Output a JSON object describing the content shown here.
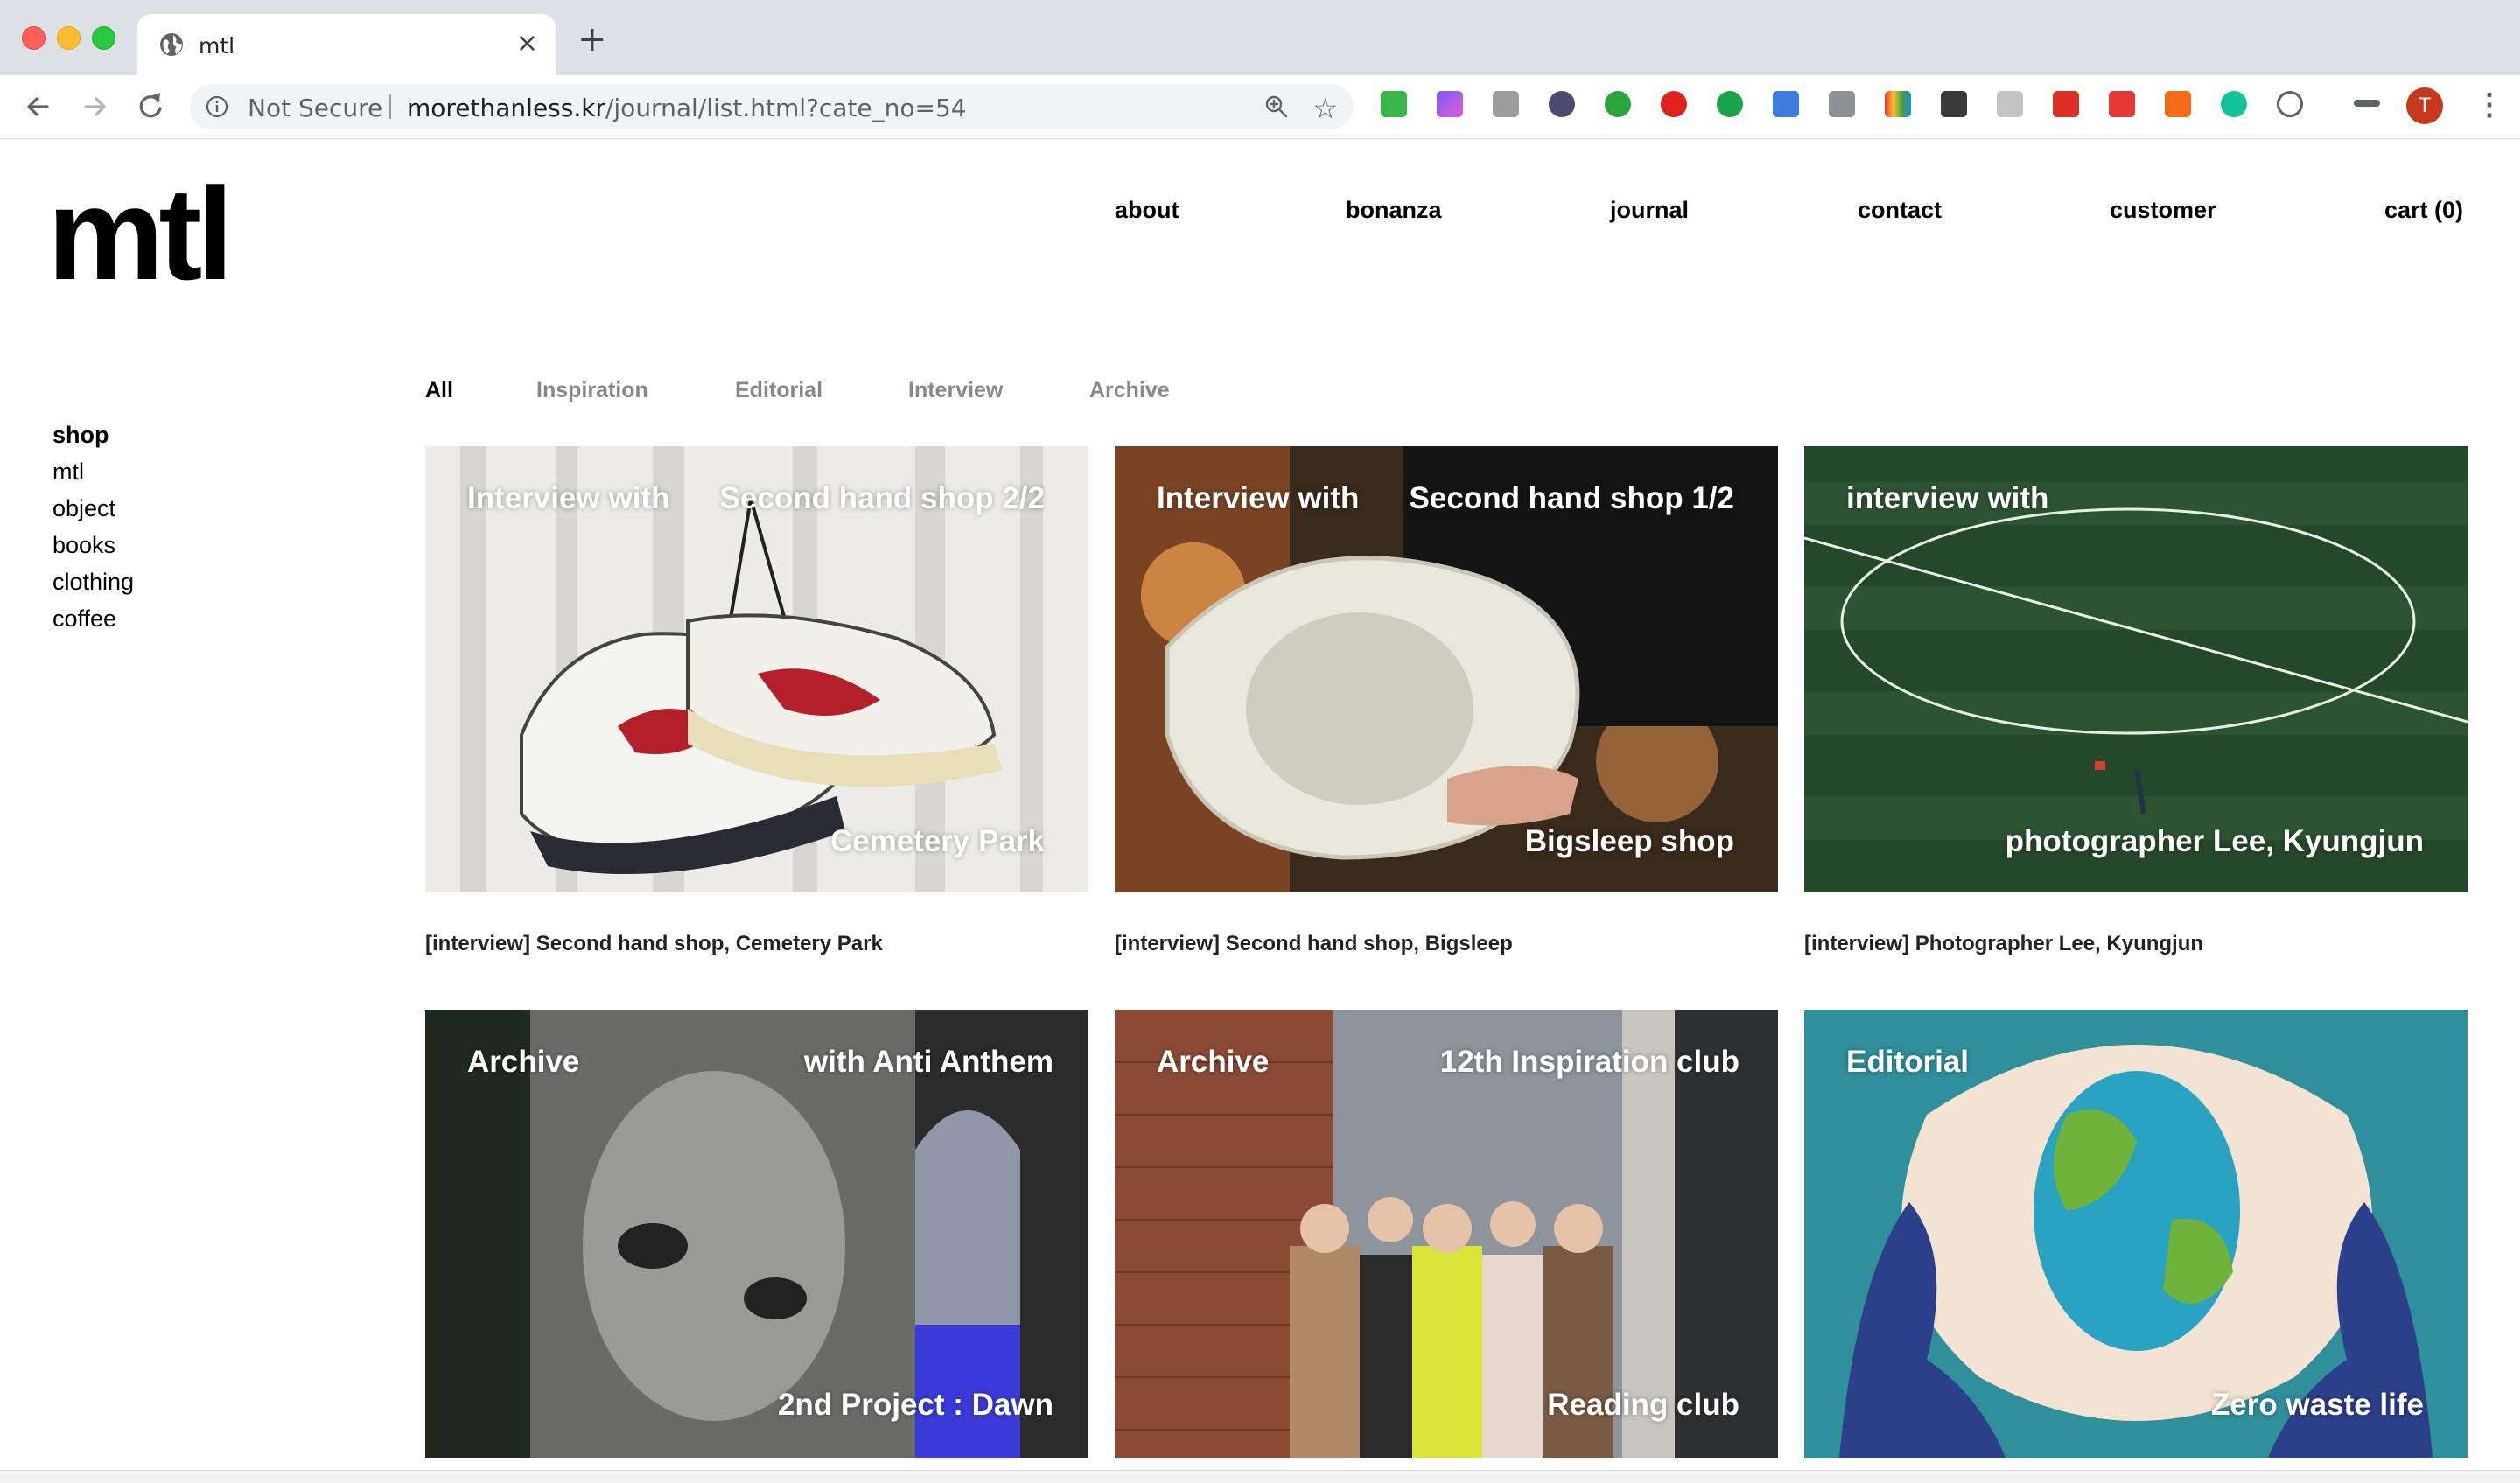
{
  "browser": {
    "tab_title": "mtl",
    "tab_close": "×",
    "new_tab": "+",
    "security_label": "Not Secure",
    "url_host": "morethanless.kr",
    "url_path": "/journal/list.html?cate_no=54",
    "profile_initial": "T",
    "menu_glyph": "⋮",
    "star_glyph": "☆"
  },
  "site": {
    "logo": "mtl",
    "nav": [
      "about",
      "bonanza",
      "journal",
      "contact",
      "customer",
      "cart (0)"
    ],
    "sidebar": {
      "heading": "shop",
      "items": [
        "mtl",
        "object",
        "books",
        "clothing",
        "coffee"
      ]
    },
    "categories": {
      "active": "All",
      "items": [
        "Inspiration",
        "Editorial",
        "Interview",
        "Archive"
      ]
    },
    "posts": [
      {
        "tl": "Interview with",
        "tr": "Second hand shop 2/2",
        "br": "Cemetery Park",
        "caption": "[interview] Second hand shop, Cemetery Park"
      },
      {
        "tl": "Interview with",
        "tr": "Second hand shop 1/2",
        "br": "Bigsleep shop",
        "caption": "[interview] Second hand shop, Bigsleep"
      },
      {
        "tl": "interview with",
        "tr": "",
        "br": "photographer Lee, Kyungjun",
        "caption": "[interview] Photographer Lee, Kyungjun"
      },
      {
        "tl": "Archive",
        "tr": "with Anti Anthem",
        "br": "2nd Project : Dawn",
        "caption": ""
      },
      {
        "tl": "Archive",
        "tr": "12th Inspiration club",
        "br": "Reading club",
        "caption": ""
      },
      {
        "tl": "Editorial",
        "tr": "",
        "br": "Zero waste life",
        "caption": ""
      }
    ]
  }
}
